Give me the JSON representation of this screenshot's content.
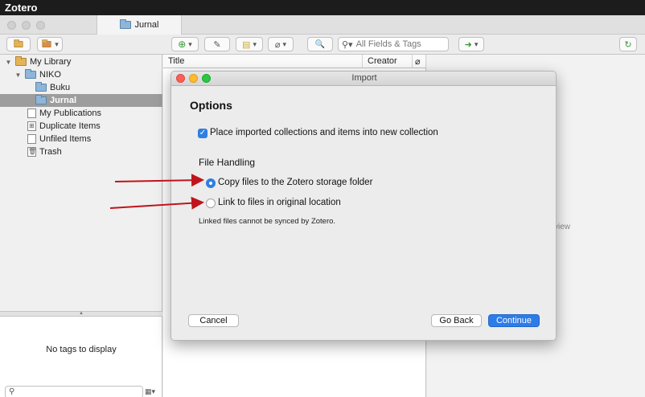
{
  "menubar": {
    "app_name": "Zotero"
  },
  "window": {
    "tab_label": "Jurnal"
  },
  "toolbar": {
    "search_placeholder": "All Fields & Tags"
  },
  "sidebar": {
    "items": [
      {
        "label": "My Library"
      },
      {
        "label": "NIKO"
      },
      {
        "label": "Buku"
      },
      {
        "label": "Jurnal"
      },
      {
        "label": "My Publications"
      },
      {
        "label": "Duplicate Items"
      },
      {
        "label": "Unfiled Items"
      },
      {
        "label": "Trash"
      }
    ]
  },
  "tags": {
    "empty_text": "No tags to display"
  },
  "items_pane": {
    "col_title": "Title",
    "col_creator": "Creator"
  },
  "right_pane": {
    "partial_text": "view"
  },
  "dialog": {
    "title": "Import",
    "heading": "Options",
    "checkbox_label": "Place imported collections and items into new collection",
    "section_title": "File Handling",
    "radio_copy": "Copy files to the Zotero storage folder",
    "radio_link": "Link to files in original location",
    "note": "Linked files cannot be synced by Zotero.",
    "cancel": "Cancel",
    "back": "Go Back",
    "continue": "Continue"
  },
  "colors": {
    "accent": "#2d7ce8",
    "annotation_arrow": "#c0141c"
  }
}
